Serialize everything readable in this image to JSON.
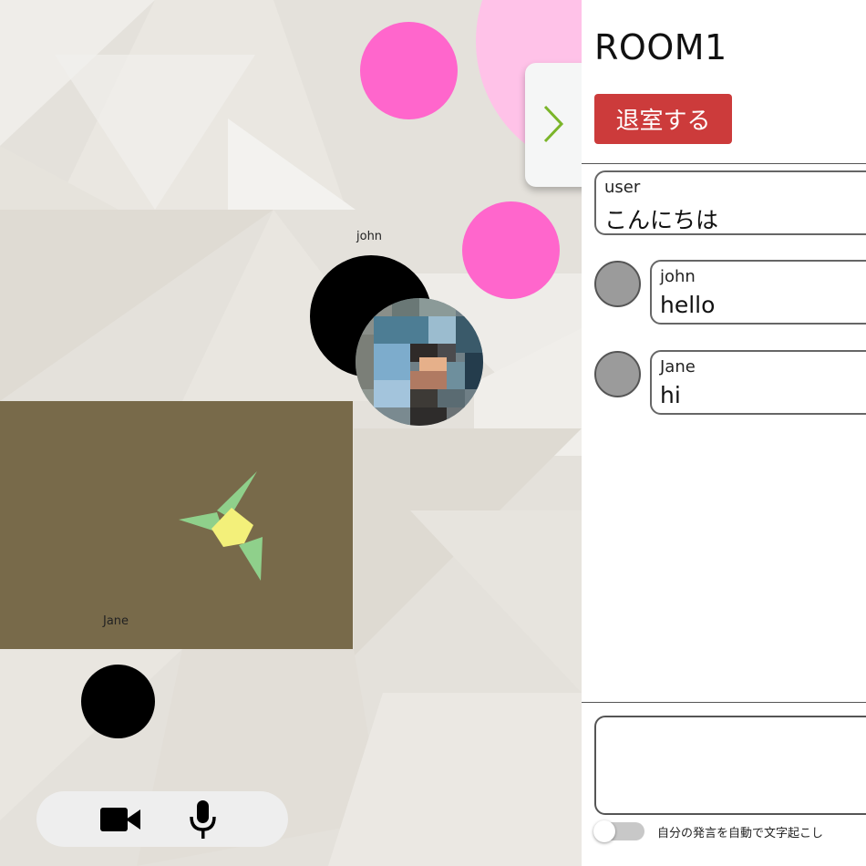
{
  "room": {
    "title": "ROOM1",
    "leave_label": "退室する"
  },
  "canvas": {
    "participants": [
      {
        "name": "john",
        "label_visible": true
      },
      {
        "name": "Jane",
        "label_visible": true
      }
    ]
  },
  "chat": {
    "messages": [
      {
        "sender": "user",
        "text": "こんにちは",
        "own": true
      },
      {
        "sender": "john",
        "text": "hello",
        "own": false
      },
      {
        "sender": "Jane",
        "text": "hi",
        "own": false
      }
    ],
    "input": {
      "value": "",
      "placeholder": ""
    },
    "auto_transcribe": {
      "label": "自分の発言を自動で文字起こし",
      "enabled": false
    }
  },
  "controls": {
    "camera_icon": "video-camera-icon",
    "mic_icon": "microphone-icon",
    "toggle_icon": "chevron-right-icon"
  },
  "colors": {
    "accent_pink": "#ff66cc",
    "pale_pink": "#ffc2e8",
    "leave_button": "#cc3b3b",
    "share_background": "#786a4a",
    "chevron": "#7bb52a"
  }
}
